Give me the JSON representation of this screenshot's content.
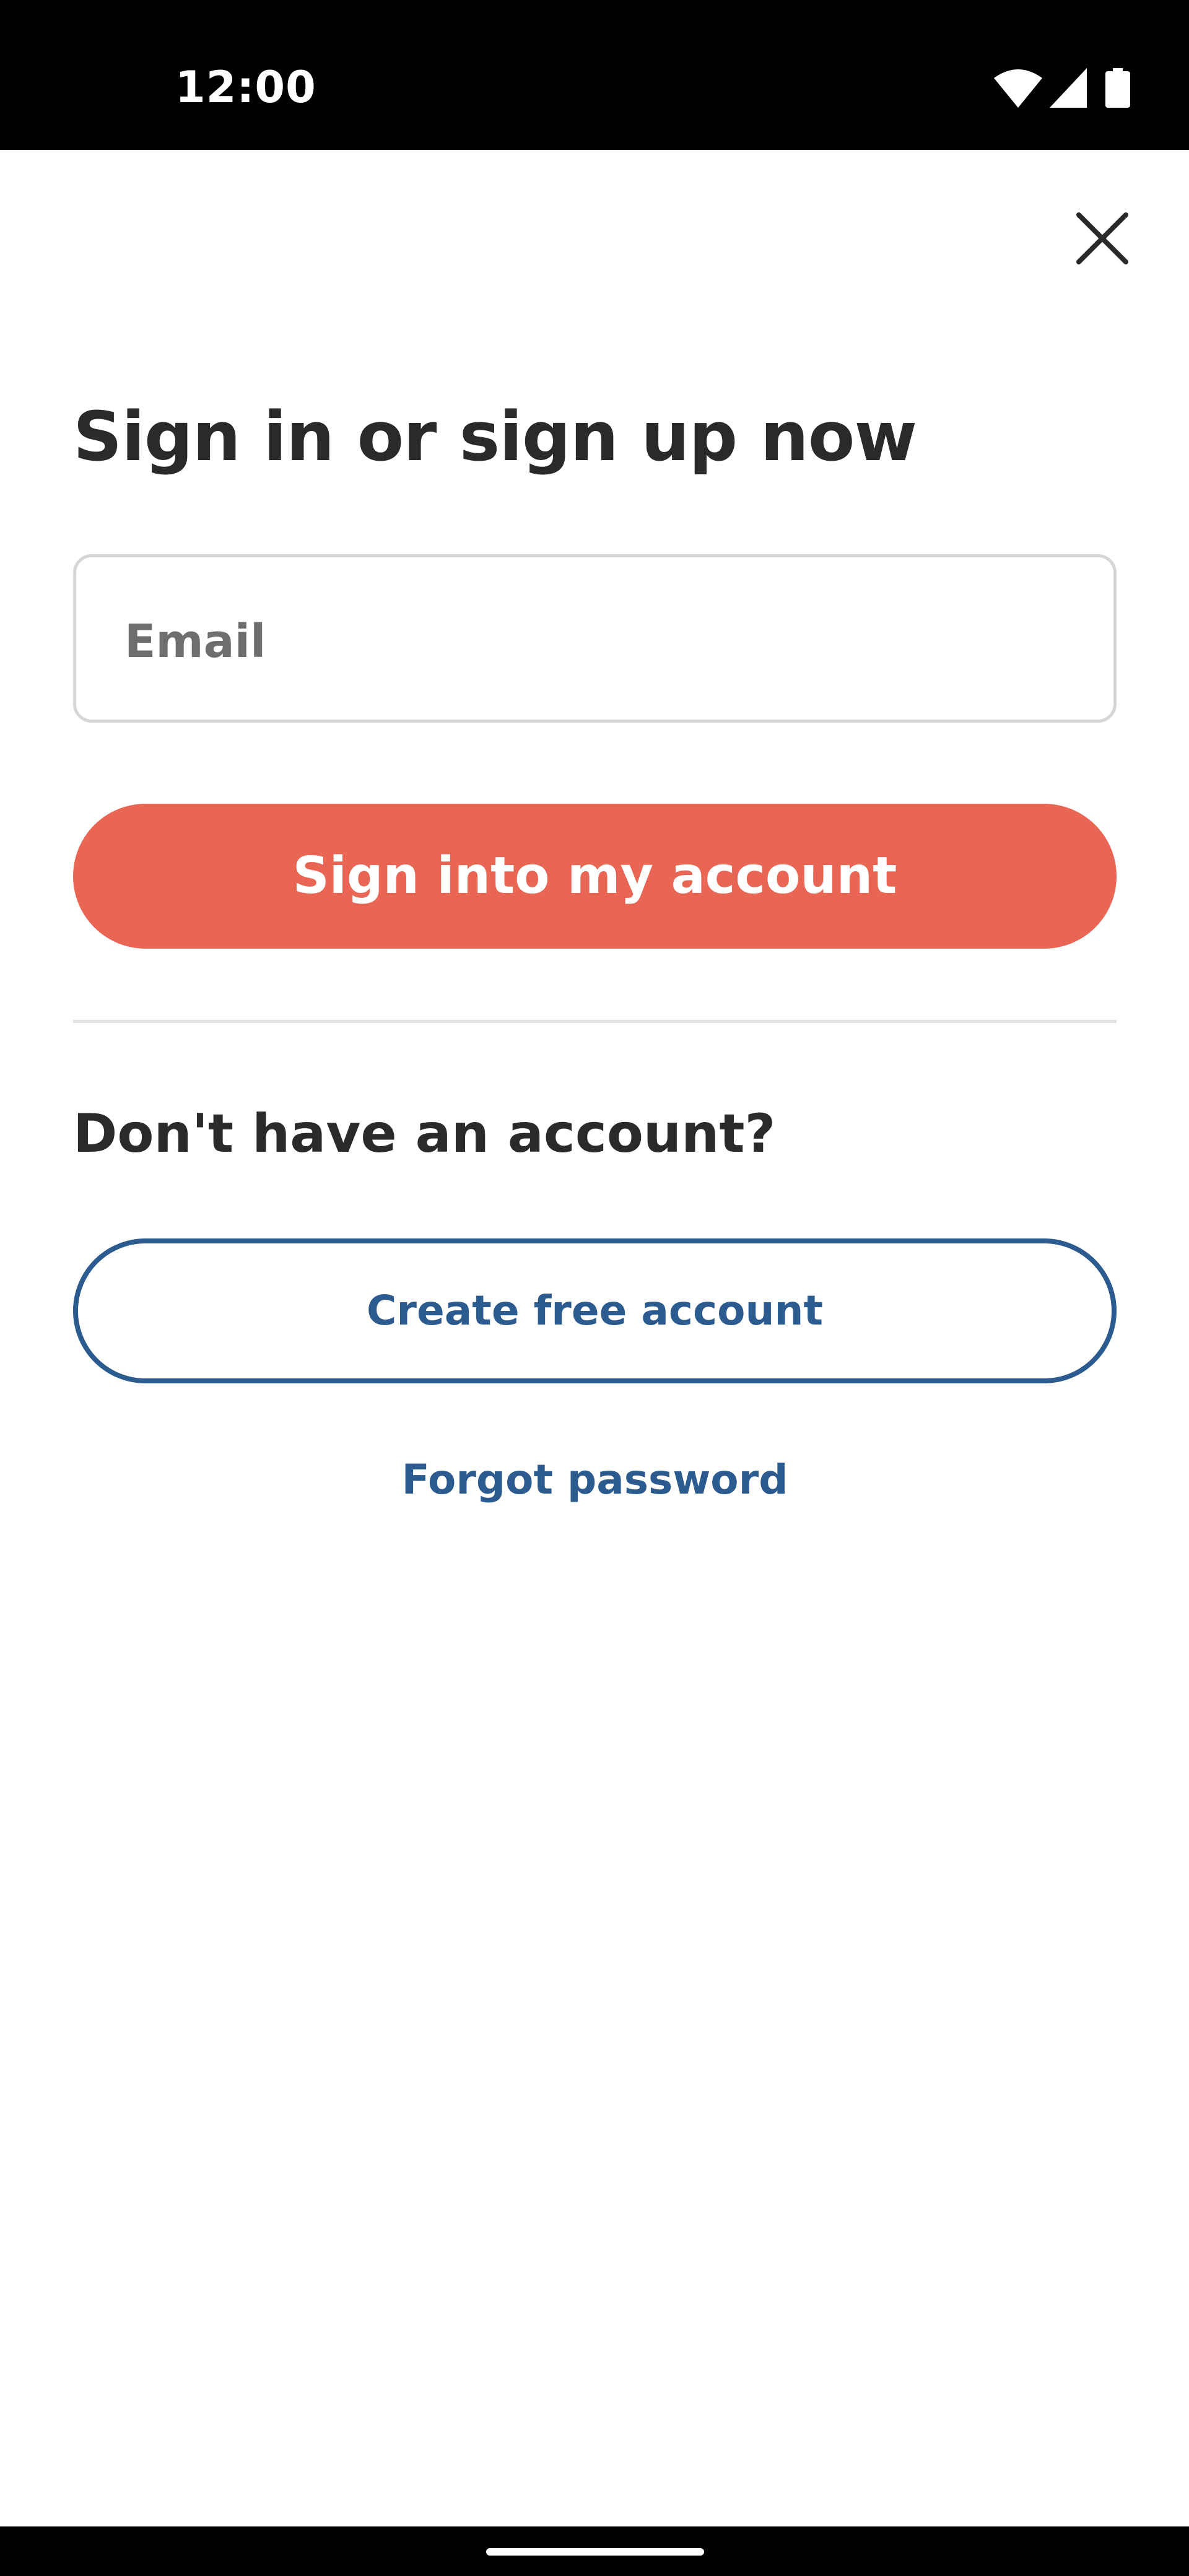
{
  "status_bar": {
    "time": "12:00",
    "icons": [
      "wifi-icon",
      "cellular-signal-icon",
      "battery-icon"
    ]
  },
  "dialog": {
    "close_icon": "close-icon",
    "title": "Sign in or sign up now",
    "email": {
      "value": "",
      "placeholder": "Email"
    },
    "signin_button_label": "Sign into my account",
    "no_account_heading": "Don't have an account?",
    "create_account_label": "Create free account",
    "forgot_password_label": "Forgot password"
  },
  "colors": {
    "primary_button": "#e96554",
    "link_blue": "#2b5b8f",
    "heading_text": "#2a2a2a",
    "placeholder_text": "#6e6e6e",
    "field_border": "#d6d6d6",
    "divider": "#e0e0e0"
  }
}
